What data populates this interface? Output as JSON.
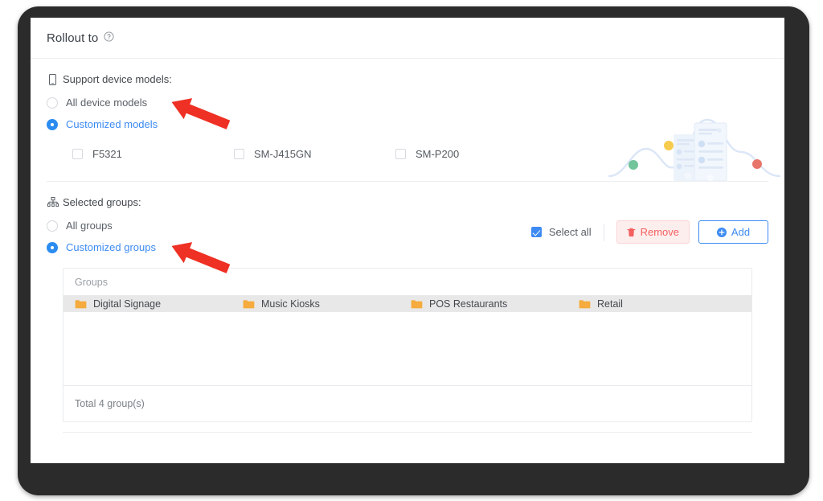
{
  "panel": {
    "title": "Rollout to",
    "help_icon": "question-circle-icon"
  },
  "device_models": {
    "label": "Support device models:",
    "label_icon": "mobile-device-icon",
    "options": [
      {
        "label": "All device models",
        "selected": false
      },
      {
        "label": "Customized models",
        "selected": true
      }
    ],
    "models": [
      {
        "label": "F5321",
        "checked": false
      },
      {
        "label": "SM-J415GN",
        "checked": false
      },
      {
        "label": "SM-P200",
        "checked": false
      }
    ]
  },
  "selected_groups": {
    "label": "Selected groups:",
    "label_icon": "org-chart-icon",
    "options": [
      {
        "label": "All groups",
        "selected": false
      },
      {
        "label": "Customized groups",
        "selected": true
      }
    ],
    "toolbar": {
      "select_all_label": "Select all",
      "select_all_checked": true,
      "remove_label": "Remove",
      "remove_icon": "trash-icon",
      "add_label": "Add",
      "add_icon": "plus-circle-icon"
    },
    "table": {
      "column_header": "Groups",
      "row_icon": "folder-icon",
      "rows": [
        {
          "name": "Digital Signage"
        },
        {
          "name": "Music Kiosks"
        },
        {
          "name": "POS Restaurants"
        },
        {
          "name": "Retail"
        }
      ],
      "footer": "Total 4 group(s)"
    }
  },
  "annotations": [
    {
      "name": "arrow-pointing-to-customized-models",
      "color": "#ee3124"
    },
    {
      "name": "arrow-pointing-to-customized-groups",
      "color": "#ee3124"
    }
  ],
  "colors": {
    "accent_blue": "#3d8bf2",
    "remove_red": "#f46060",
    "folder_orange": "#f5ab3d",
    "annotation_red": "#ee3124",
    "row_selected_gray": "#e8e8e8"
  },
  "watermark": {
    "name": "devices-chart-illustration",
    "dots": [
      {
        "color": "#72c49a"
      },
      {
        "color": "#f7cb4d"
      },
      {
        "color": "#e8756a"
      }
    ]
  }
}
